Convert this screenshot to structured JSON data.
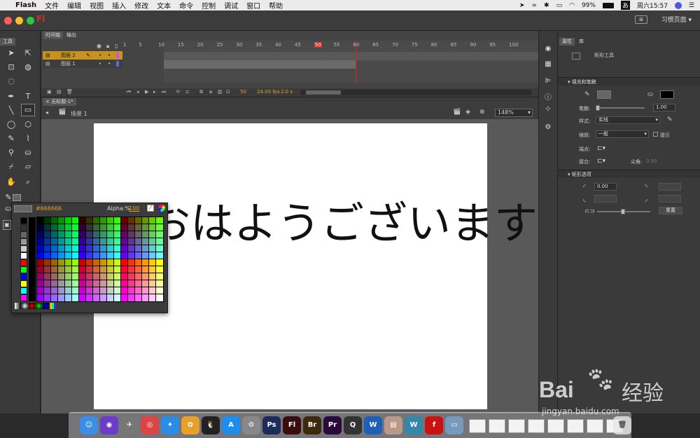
{
  "menubar": {
    "apple": "",
    "app": "Flash",
    "items": [
      "文件",
      "编辑",
      "视图",
      "插入",
      "修改",
      "文本",
      "命令",
      "控制",
      "调试",
      "窗口",
      "帮助"
    ],
    "battery": "99%",
    "clock": "周六15:57"
  },
  "titlebar": {
    "app_glyph": "Fl",
    "workspace": "习惯页面"
  },
  "tools_panel": {
    "tab": "工具"
  },
  "timeline": {
    "tabs": [
      "时间轴",
      "输出"
    ],
    "ruler": [
      "1",
      "5",
      "10",
      "15",
      "20",
      "25",
      "30",
      "35",
      "40",
      "45",
      "50",
      "55",
      "60",
      "65",
      "70",
      "75",
      "80",
      "85",
      "90",
      "95",
      "100"
    ],
    "layers": [
      {
        "name": "图层 2",
        "color": "#e0a02a",
        "selected": true
      },
      {
        "name": "图层 1",
        "color": "#5a6cdd",
        "selected": false
      }
    ],
    "current_frame": "50",
    "fps": "24.00 fps",
    "seconds": "2.0 s"
  },
  "document": {
    "tab": "无标题-1*",
    "scene": "场景 1",
    "zoom": "148%"
  },
  "stage": {
    "text": "おはようございます"
  },
  "color_picker": {
    "hex": "#666666",
    "alpha_label": "Alpha:%",
    "alpha_value": "100"
  },
  "properties": {
    "tabs": [
      "属性",
      "库"
    ],
    "tool_name": "矩形工具",
    "fill_stroke_section": "填充和笔触",
    "stroke_label": "笔触:",
    "stroke_value": "1.00",
    "style_label": "样式:",
    "style_value": "实线",
    "scale_label": "缩放:",
    "scale_value": "一般",
    "hint_label": "提示",
    "cap_label": "端点:",
    "join_label": "接合:",
    "miter_label": "尖角:",
    "miter_value": "3.00",
    "rect_section": "矩形选项",
    "radius_value": "0.00",
    "reset_label": "重置",
    "stroke_color": "#666666",
    "fill_color": "#000000"
  },
  "dock": {
    "apps": [
      {
        "name": "finder",
        "label": "☺",
        "color": "#3a8ee6"
      },
      {
        "name": "siri",
        "label": "◉",
        "color": "#6a3cc9"
      },
      {
        "name": "launchpad",
        "label": "✈",
        "color": "#777"
      },
      {
        "name": "chrome",
        "label": "◎",
        "color": "#d44"
      },
      {
        "name": "safari",
        "label": "✦",
        "color": "#2a8ce6"
      },
      {
        "name": "photos",
        "label": "✿",
        "color": "#e8a02a"
      },
      {
        "name": "qq",
        "label": "🐧",
        "color": "#222"
      },
      {
        "name": "app-store",
        "label": "A",
        "color": "#1c8ef0"
      },
      {
        "name": "system-preferences",
        "label": "⚙",
        "color": "#888"
      },
      {
        "name": "photoshop",
        "label": "Ps",
        "color": "#1d2b5a"
      },
      {
        "name": "flash",
        "label": "Fl",
        "color": "#3a0d0d"
      },
      {
        "name": "bridge",
        "label": "Br",
        "color": "#3b2b0a"
      },
      {
        "name": "premiere",
        "label": "Pr",
        "color": "#2a0a3a"
      },
      {
        "name": "quicktime",
        "label": "Q",
        "color": "#333"
      },
      {
        "name": "word",
        "label": "W",
        "color": "#1f5fb8"
      },
      {
        "name": "archive-utility",
        "label": "▤",
        "color": "#b98"
      },
      {
        "name": "wps",
        "label": "W",
        "color": "#38a"
      },
      {
        "name": "flash-player",
        "label": "f",
        "color": "#c11"
      },
      {
        "name": "preview",
        "label": "▭",
        "color": "#79b"
      }
    ]
  },
  "watermark": {
    "brand": "Bai",
    "brand2": "经验",
    "url": "jingyan.baidu.com"
  }
}
